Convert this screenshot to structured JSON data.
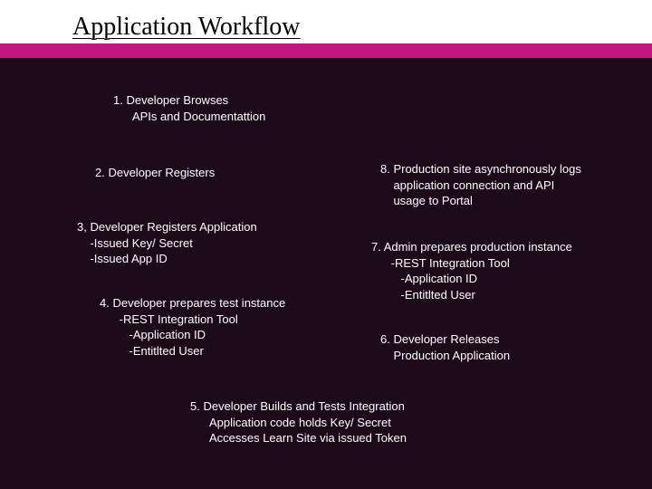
{
  "title": "Application Workflow",
  "steps": {
    "s1": "1. Developer Browses\n      APIs and Documentattion",
    "s2": "2. Developer Registers",
    "s3": "3, Developer Registers Application\n    -Issued Key/ Secret\n    -Issued App ID",
    "s4": "4. Developer prepares test instance\n      -REST Integration Tool\n         -Application ID\n         -Entitlted User",
    "s5": "5. Developer Builds and Tests Integration\n      Application code holds Key/ Secret\n      Accesses Learn Site via issued Token",
    "s6": "6. Developer Releases\n    Production Application",
    "s7": "7. Admin prepares production instance\n      -REST Integration Tool\n         -Application ID\n         -Entitlted User",
    "s8": "8. Production site asynchronously logs\n    application connection and API\n    usage to Portal"
  }
}
